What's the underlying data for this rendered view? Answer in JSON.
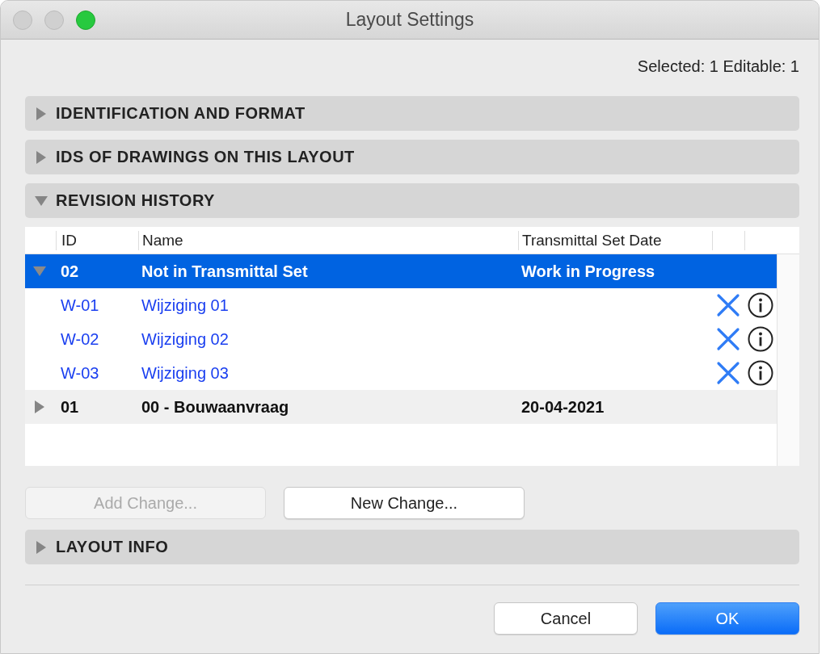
{
  "window": {
    "title": "Layout Settings"
  },
  "selection_info": "Selected: 1 Editable: 1",
  "sections": [
    {
      "title": "IDENTIFICATION AND FORMAT",
      "expanded": false
    },
    {
      "title": "IDS OF DRAWINGS ON THIS LAYOUT",
      "expanded": false
    },
    {
      "title": "REVISION HISTORY",
      "expanded": true,
      "table": {
        "columns": [
          "ID",
          "Name",
          "Transmittal Set Date"
        ],
        "rows": [
          {
            "id": "02",
            "name": "Not in Transmittal Set",
            "date": "Work in Progress",
            "expanded": true,
            "selected": true,
            "children": [
              {
                "id": "W-01",
                "name": "Wijziging 01"
              },
              {
                "id": "W-02",
                "name": "Wijziging 02"
              },
              {
                "id": "W-03",
                "name": "Wijziging 03"
              }
            ]
          },
          {
            "id": "01",
            "name": "00 - Bouwaanvraag",
            "date": "20-04-2021",
            "expanded": false,
            "selected": false
          }
        ]
      },
      "buttons": [
        {
          "label": "Add Change...",
          "disabled": true
        },
        {
          "label": "New Change...",
          "disabled": false
        }
      ]
    },
    {
      "title": "LAYOUT INFO",
      "expanded": false
    }
  ],
  "footer_buttons": [
    {
      "label": "Cancel",
      "kind": "normal"
    },
    {
      "label": "OK",
      "kind": "default"
    }
  ]
}
